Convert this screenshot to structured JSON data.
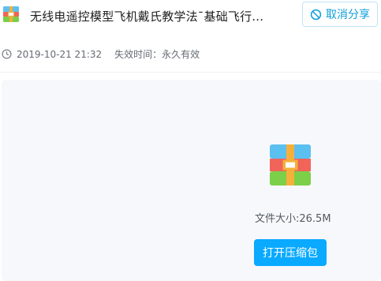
{
  "header": {
    "file_icon": "archive-icon",
    "title": "无线电遥控模型飞机戴氏教学法¯基础飞行...",
    "cancel_share": {
      "icon": "prohibited-icon",
      "label": "取消分享"
    },
    "meta": {
      "clock_icon": "clock-icon",
      "timestamp": "2019-10-21 21:32",
      "expire_label": "失效时间：永久有效"
    }
  },
  "panel": {
    "file_icon": "archive-icon",
    "size_label": "文件大小:26.5M",
    "open_button": "打开压缩包"
  },
  "colors": {
    "accent": "#09aaff",
    "cancel_text": "#0d9ed8",
    "panel_bg": "#f6f8fb"
  }
}
